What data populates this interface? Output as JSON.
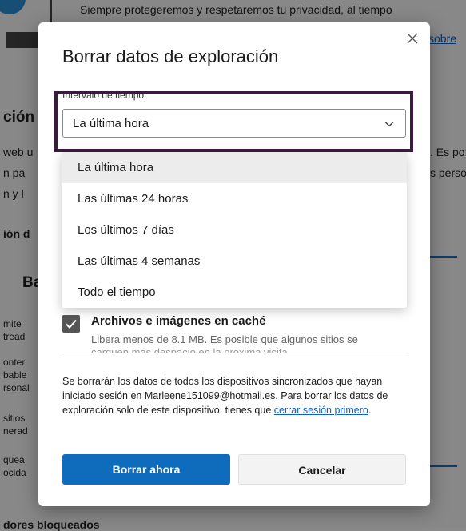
{
  "background": {
    "top_text": "Siempre protegeremos y respetaremos tu privacidad, al tiempo",
    "top_link": "sobre",
    "left_fragments": [
      "ción",
      "web u",
      "n pa",
      "n y l",
      "ión d",
      "Ba",
      "mite",
      "tread",
      "onter",
      "bable",
      "rsonal",
      "sitios",
      "nerad",
      "quea",
      "ocida"
    ],
    "right_fragments": [
      ". Es po",
      "s perso"
    ],
    "bottom_text": "dores bloqueados"
  },
  "dialog": {
    "title": "Borrar datos de exploración",
    "close_icon": "close-icon",
    "time_range": {
      "label": "Intervalo de tiempo",
      "selected": "La última hora",
      "options": [
        "La última hora",
        "Las últimas 24 horas",
        "Los últimos 7 días",
        "Las últimas 4 semanas",
        "Todo el tiempo"
      ]
    },
    "cache_option": {
      "checked": true,
      "title": "Archivos e imágenes en caché",
      "description": "Libera menos de 8.1 MB. Es posible que algunos sitios se",
      "description_cont": "carguen más despacio en la próxima visita."
    },
    "notice": {
      "text": "Se borrarán los datos de todos los dispositivos sincronizados que hayan iniciado sesión en Marleene151099@hotmail.es. Para borrar los datos de exploración solo de este dispositivo, tienes que ",
      "link": "cerrar sesión primero",
      "suffix": "."
    },
    "buttons": {
      "primary": "Borrar ahora",
      "secondary": "Cancelar"
    }
  },
  "colors": {
    "primary": "#0f6cbd",
    "highlight_border": "#3b1a3f"
  }
}
